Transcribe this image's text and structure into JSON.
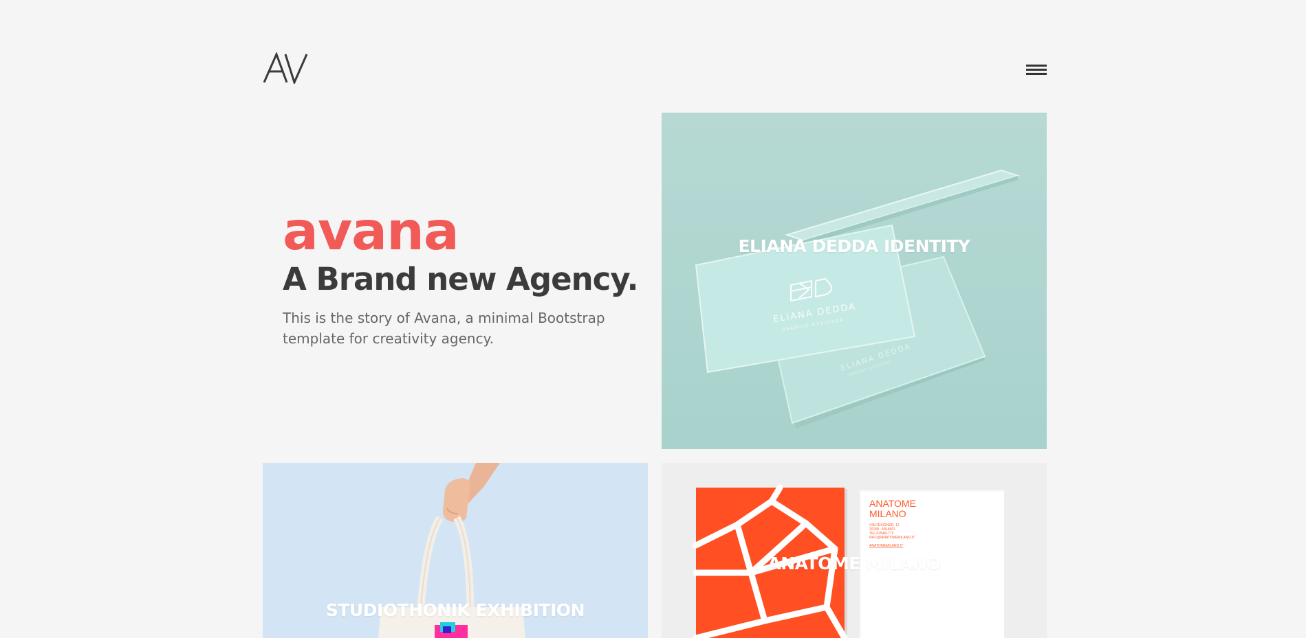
{
  "header": {
    "logo_icon": "av-logo-icon",
    "menu_icon": "hamburger-menu-icon"
  },
  "hero": {
    "brand": "avana",
    "tagline": "A Brand new Agency.",
    "description": "This is the story of Avana, a minimal Bootstrap template for creativity agency."
  },
  "portfolio": {
    "items": [
      {
        "title": "ELIANA DEDDA IDENTITY"
      },
      {
        "title": "STUDIOTHONIK EXHIBITION"
      },
      {
        "title": "ANATOME MILANO"
      }
    ]
  },
  "mockups": {
    "eliana_card_text": "ELIANA DEDDA",
    "eliana_card_subtext": "GRAPHIC DESIGNER",
    "anatome_card_title": "ANATOME",
    "anatome_card_subtitle": "MILANO",
    "anatome_card_details": [
      "VIA DESIGNER, 12",
      "20158 - MILANO",
      "TEL 025461773",
      "INFO@ANATOMEMILANO.IT"
    ],
    "anatome_card_url": "ANATOMEMILANO.IT"
  },
  "colors": {
    "brand": "#f25a58",
    "heading": "#3b3b3b",
    "body_text": "#666666",
    "background": "#f5f5f5",
    "eliana_bg": "#b1d7d2",
    "studio_bg": "#d3e4f4",
    "anatome_orange": "#ff4f23"
  }
}
